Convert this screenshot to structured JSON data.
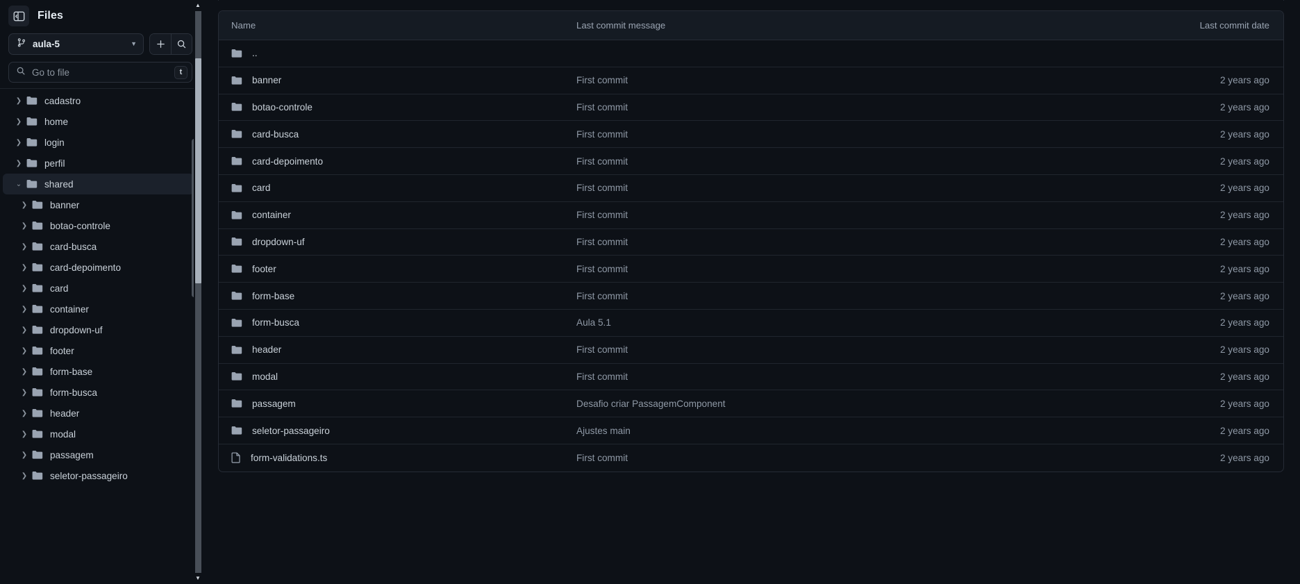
{
  "sidebar": {
    "title": "Files",
    "panel_toggle_icon": "panel-collapse-icon",
    "branch": {
      "icon": "git-branch-icon",
      "name": "aula-5",
      "caret_icon": "chevron-down-icon",
      "add_icon": "plus-icon",
      "search_icon": "search-icon"
    },
    "search": {
      "icon": "search-icon",
      "placeholder": "Go to file",
      "value": "",
      "shortcut_key": "t"
    },
    "tree": [
      {
        "label": "",
        "depth": 1,
        "type": "folder",
        "state": "collapsed",
        "partial": true
      },
      {
        "label": "cadastro",
        "depth": 1,
        "type": "folder",
        "state": "collapsed"
      },
      {
        "label": "home",
        "depth": 1,
        "type": "folder",
        "state": "collapsed"
      },
      {
        "label": "login",
        "depth": 1,
        "type": "folder",
        "state": "collapsed"
      },
      {
        "label": "perfil",
        "depth": 1,
        "type": "folder",
        "state": "collapsed"
      },
      {
        "label": "shared",
        "depth": 1,
        "type": "folder",
        "state": "expanded",
        "selected": true
      },
      {
        "label": "banner",
        "depth": 2,
        "type": "folder",
        "state": "collapsed"
      },
      {
        "label": "botao-controle",
        "depth": 2,
        "type": "folder",
        "state": "collapsed"
      },
      {
        "label": "card-busca",
        "depth": 2,
        "type": "folder",
        "state": "collapsed"
      },
      {
        "label": "card-depoimento",
        "depth": 2,
        "type": "folder",
        "state": "collapsed"
      },
      {
        "label": "card",
        "depth": 2,
        "type": "folder",
        "state": "collapsed"
      },
      {
        "label": "container",
        "depth": 2,
        "type": "folder",
        "state": "collapsed"
      },
      {
        "label": "dropdown-uf",
        "depth": 2,
        "type": "folder",
        "state": "collapsed"
      },
      {
        "label": "footer",
        "depth": 2,
        "type": "folder",
        "state": "collapsed"
      },
      {
        "label": "form-base",
        "depth": 2,
        "type": "folder",
        "state": "collapsed"
      },
      {
        "label": "form-busca",
        "depth": 2,
        "type": "folder",
        "state": "collapsed"
      },
      {
        "label": "header",
        "depth": 2,
        "type": "folder",
        "state": "collapsed"
      },
      {
        "label": "modal",
        "depth": 2,
        "type": "folder",
        "state": "collapsed"
      },
      {
        "label": "passagem",
        "depth": 2,
        "type": "folder",
        "state": "collapsed"
      },
      {
        "label": "seletor-passageiro",
        "depth": 2,
        "type": "folder",
        "state": "collapsed"
      }
    ]
  },
  "main": {
    "table": {
      "columns": [
        "Name",
        "Last commit message",
        "Last commit date"
      ],
      "rows": [
        {
          "name": "..",
          "type": "folder",
          "message": "",
          "date": ""
        },
        {
          "name": "banner",
          "type": "folder",
          "message": "First commit",
          "date": "2 years ago"
        },
        {
          "name": "botao-controle",
          "type": "folder",
          "message": "First commit",
          "date": "2 years ago"
        },
        {
          "name": "card-busca",
          "type": "folder",
          "message": "First commit",
          "date": "2 years ago"
        },
        {
          "name": "card-depoimento",
          "type": "folder",
          "message": "First commit",
          "date": "2 years ago"
        },
        {
          "name": "card",
          "type": "folder",
          "message": "First commit",
          "date": "2 years ago"
        },
        {
          "name": "container",
          "type": "folder",
          "message": "First commit",
          "date": "2 years ago"
        },
        {
          "name": "dropdown-uf",
          "type": "folder",
          "message": "First commit",
          "date": "2 years ago"
        },
        {
          "name": "footer",
          "type": "folder",
          "message": "First commit",
          "date": "2 years ago"
        },
        {
          "name": "form-base",
          "type": "folder",
          "message": "First commit",
          "date": "2 years ago"
        },
        {
          "name": "form-busca",
          "type": "folder",
          "message": "Aula 5.1",
          "date": "2 years ago"
        },
        {
          "name": "header",
          "type": "folder",
          "message": "First commit",
          "date": "2 years ago"
        },
        {
          "name": "modal",
          "type": "folder",
          "message": "First commit",
          "date": "2 years ago"
        },
        {
          "name": "passagem",
          "type": "folder",
          "message": "Desafio criar PassagemComponent",
          "date": "2 years ago"
        },
        {
          "name": "seletor-passageiro",
          "type": "folder",
          "message": "Ajustes main",
          "date": "2 years ago"
        },
        {
          "name": "form-validations.ts",
          "type": "file",
          "message": "First commit",
          "date": "2 years ago"
        }
      ]
    },
    "scrollbar": {
      "up_arrow_icon": "caret-up-icon",
      "down_arrow_icon": "caret-down-icon"
    }
  },
  "colors": {
    "background": "#0d1117",
    "panel_border": "#262c36",
    "header_bg": "#151b23",
    "text_primary": "#c9d1d9",
    "text_muted": "#8f99a6",
    "selected_row": "#1b212b",
    "folder_icon": "#9aa4b2"
  }
}
